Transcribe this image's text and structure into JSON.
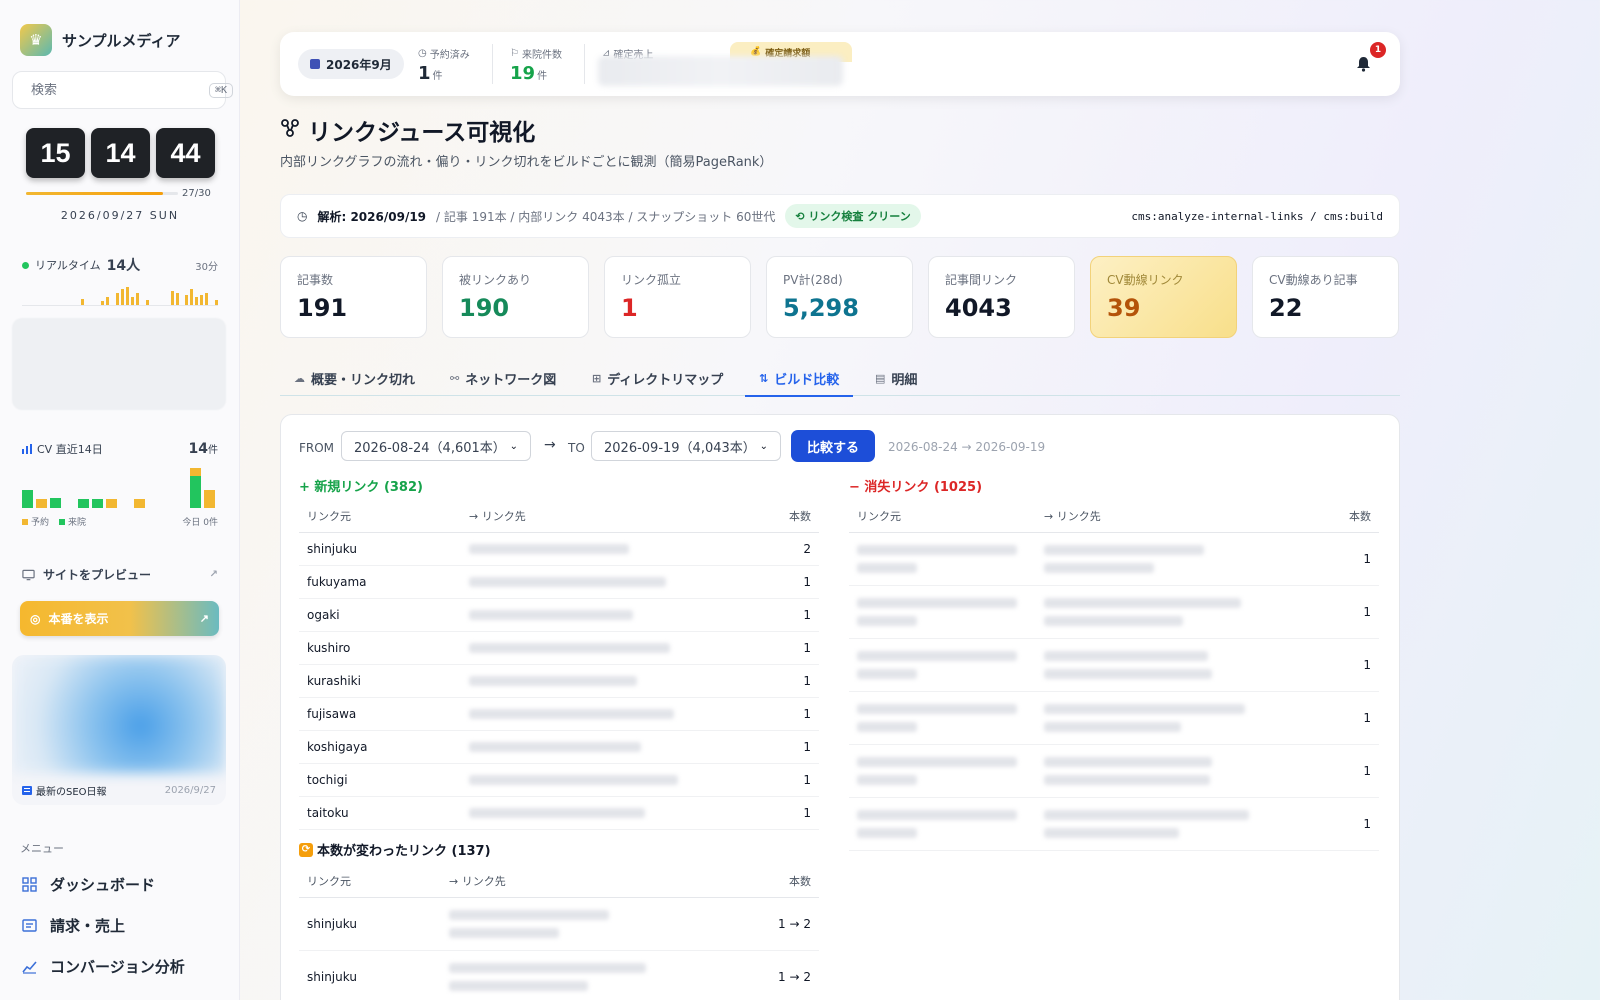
{
  "brand": {
    "name": "サンプルメディア"
  },
  "search": {
    "placeholder": "検索",
    "shortcut": "⌘K"
  },
  "clock": {
    "hh": "15",
    "mm": "14",
    "ss": "44",
    "progress_fraction": 0.9,
    "progress_label": "27/30",
    "date": "2026/09/27 SUN"
  },
  "realtime": {
    "label": "リアルタイム",
    "count": "14人",
    "period": "30分",
    "bars": [
      0,
      0,
      0,
      0,
      0,
      0,
      0,
      0,
      0,
      0,
      0,
      0,
      6,
      0,
      0,
      0,
      4,
      8,
      0,
      12,
      16,
      18,
      8,
      12,
      0,
      5,
      0,
      0,
      0,
      0,
      14,
      12,
      0,
      10,
      16,
      8,
      10,
      12,
      0,
      5
    ]
  },
  "cv": {
    "label": "CV 直近14日",
    "count": "14",
    "unit": "件",
    "days": [
      {
        "y": 0,
        "g": 18
      },
      {
        "y": 9,
        "g": 0
      },
      {
        "y": 0,
        "g": 10
      },
      {
        "y": 0,
        "g": 0
      },
      {
        "y": 0,
        "g": 9
      },
      {
        "y": 0,
        "g": 9
      },
      {
        "y": 9,
        "g": 0
      },
      {
        "y": 0,
        "g": 0
      },
      {
        "y": 9,
        "g": 0
      },
      {
        "y": 0,
        "g": 0
      },
      {
        "y": 0,
        "g": 0
      },
      {
        "y": 0,
        "g": 0
      },
      {
        "y": 8,
        "g": 32
      },
      {
        "y": 18,
        "g": 0
      }
    ],
    "legend_reserve": "予約",
    "legend_visit": "来院",
    "today": "今日 0件"
  },
  "preview": {
    "label": "サイトをプレビュー"
  },
  "production": {
    "label": "本番を表示"
  },
  "news": {
    "caption": "最新のSEO日報",
    "date": "2026/9/27"
  },
  "menu": {
    "title": "メニュー",
    "items": [
      {
        "label": "ダッシュボード",
        "icon": "grid-icon"
      },
      {
        "label": "請求・売上",
        "icon": "receipt-icon"
      },
      {
        "label": "コンバージョン分析",
        "icon": "chart-line-icon"
      }
    ]
  },
  "topbar": {
    "month": "2026年9月",
    "reserved_label": "予約済み",
    "reserved_value": "1",
    "reserved_unit": "件",
    "visits_label": "来院件数",
    "visits_value": "19",
    "visits_unit": "件",
    "sales_label": "確定売上",
    "billing_label": "確定請求額",
    "notifications": "1"
  },
  "page": {
    "title": "リンクジュース可視化",
    "subtitle": "内部リンクグラフの流れ・偏り・リンク切れをビルドごとに観測（簡易PageRank）"
  },
  "analysis": {
    "date": "解析: 2026/09/19",
    "meta": "/ 記事 191本 / 内部リンク 4043本 / スナップショット 60世代",
    "status": "リンク検査 クリーン",
    "commands": "cms:analyze-internal-links / cms:build"
  },
  "kpis": [
    {
      "label": "記事数",
      "value": "191",
      "color": "#111827"
    },
    {
      "label": "被リンクあり",
      "value": "190",
      "color": "#168a5a"
    },
    {
      "label": "リンク孤立",
      "value": "1",
      "color": "#dc2626"
    },
    {
      "label": "PV計(28d)",
      "value": "5,298",
      "color": "#0e7490"
    },
    {
      "label": "記事間リンク",
      "value": "4043",
      "color": "#111827"
    },
    {
      "label": "CV動線リンク",
      "value": "39",
      "color": "#b45309"
    },
    {
      "label": "CV動線あり記事",
      "value": "22",
      "color": "#111827"
    }
  ],
  "tabs": [
    {
      "label": "概要・リンク切れ",
      "icon": "cloud-icon"
    },
    {
      "label": "ネットワーク図",
      "icon": "network-icon"
    },
    {
      "label": "ディレクトリマップ",
      "icon": "grid-icon"
    },
    {
      "label": "ビルド比較",
      "icon": "compare-icon"
    },
    {
      "label": "明細",
      "icon": "list-icon"
    }
  ],
  "compare": {
    "from_label": "FROM",
    "from_value": "2026-08-24（4,601本）",
    "to_label": "TO",
    "to_value": "2026-09-19（4,043本）",
    "button": "比較する",
    "range": "2026-08-24 → 2026-09-19"
  },
  "new_links": {
    "title": "+ 新規リンク (382)",
    "headers": [
      "リンク元",
      "→ リンク先",
      "本数"
    ],
    "rows": [
      {
        "src": "shinjuku",
        "count": "2"
      },
      {
        "src": "fukuyama",
        "count": "1"
      },
      {
        "src": "ogaki",
        "count": "1"
      },
      {
        "src": "kushiro",
        "count": "1"
      },
      {
        "src": "kurashiki",
        "count": "1"
      },
      {
        "src": "fujisawa",
        "count": "1"
      },
      {
        "src": "koshigaya",
        "count": "1"
      },
      {
        "src": "tochigi",
        "count": "1"
      },
      {
        "src": "taitoku",
        "count": "1"
      }
    ]
  },
  "lost_links": {
    "title": "− 消失リンク (1025)",
    "headers": [
      "リンク元",
      "→ リンク先",
      "本数"
    ],
    "rows": [
      {
        "count": "1"
      },
      {
        "count": "1"
      },
      {
        "count": "1"
      },
      {
        "count": "1"
      },
      {
        "count": "1"
      },
      {
        "count": "1"
      }
    ]
  },
  "changed_links": {
    "title": "本数が変わったリンク (137)",
    "headers": [
      "リンク元",
      "→ リンク先",
      "本数"
    ],
    "rows": [
      {
        "src": "shinjuku",
        "count": "1 → 2"
      },
      {
        "src": "shinjuku",
        "count": "1 → 2"
      }
    ]
  }
}
